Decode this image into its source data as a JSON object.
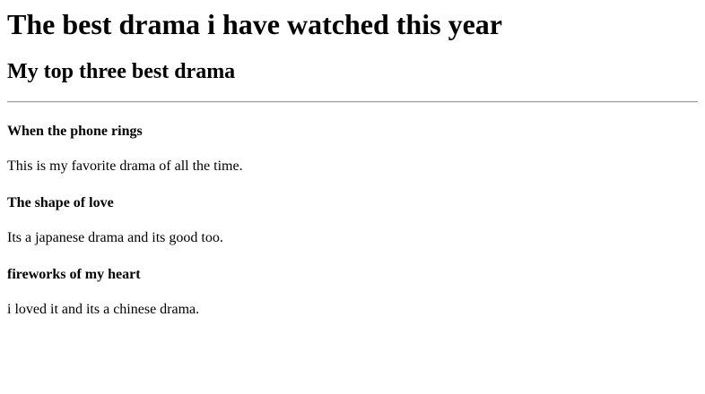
{
  "page": {
    "title": "The best drama i have watched this year",
    "subtitle": "My top three best drama"
  },
  "dramas": [
    {
      "name": "When the phone rings",
      "description": "This is my favorite drama of all the time."
    },
    {
      "name": "The shape of love",
      "description": "Its a japanese drama and its good too."
    },
    {
      "name": "fireworks of my heart",
      "description": "i loved it and its a chinese drama."
    }
  ]
}
